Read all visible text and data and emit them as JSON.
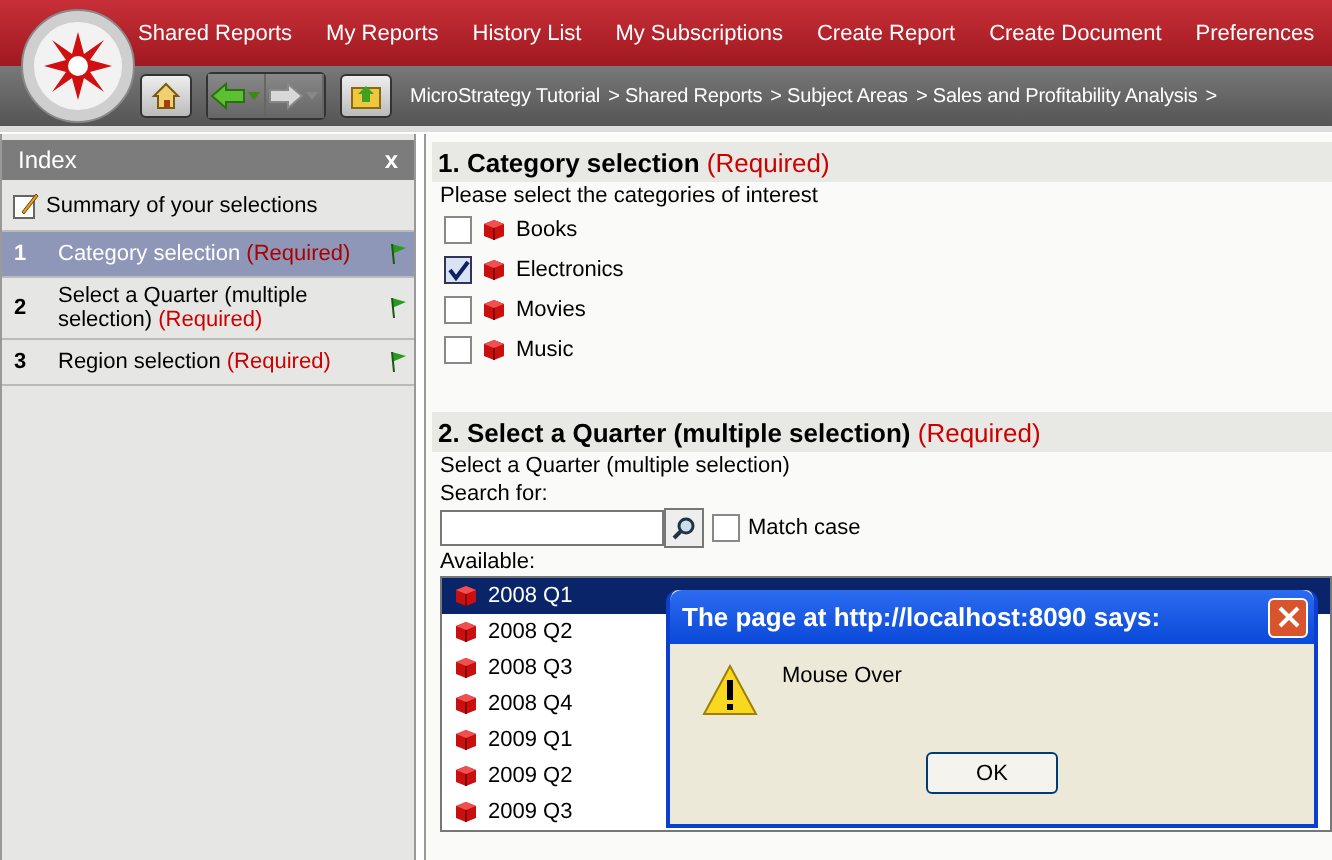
{
  "header": {
    "nav": [
      "Shared Reports",
      "My Reports",
      "History List",
      "My Subscriptions",
      "Create Report",
      "Create Document",
      "Preferences"
    ]
  },
  "toolbar": {
    "breadcrumb": [
      "MicroStrategy Tutorial",
      "> Shared Reports",
      "> Subject Areas",
      "> Sales and Profitability Analysis",
      ">"
    ]
  },
  "index": {
    "title": "Index",
    "close": "x",
    "summary": "Summary of your selections",
    "items": [
      {
        "number": "1",
        "label": "Category selection",
        "required": "(Required)",
        "selected": true
      },
      {
        "number": "2",
        "label": "Select a Quarter (multiple selection)",
        "required": "(Required)",
        "selected": false
      },
      {
        "number": "3",
        "label": "Region selection",
        "required": "(Required)",
        "selected": false
      }
    ]
  },
  "category": {
    "title": "1. Category selection",
    "required": "(Required)",
    "prompt": "Please select the categories of interest",
    "options": [
      {
        "label": "Books",
        "checked": false
      },
      {
        "label": "Electronics",
        "checked": true
      },
      {
        "label": "Movies",
        "checked": false
      },
      {
        "label": "Music",
        "checked": false
      }
    ]
  },
  "quarter": {
    "title": "2. Select a Quarter (multiple selection)",
    "required": "(Required)",
    "prompt": "Select a Quarter (multiple selection)",
    "search_label": "Search for:",
    "match_case": {
      "label": "Match case",
      "checked": false
    },
    "available_label": "Available:",
    "items": [
      {
        "label": "2008 Q1",
        "selected": true
      },
      {
        "label": "2008 Q2",
        "selected": false
      },
      {
        "label": "2008 Q3",
        "selected": false
      },
      {
        "label": "2008 Q4",
        "selected": false
      },
      {
        "label": "2009 Q1",
        "selected": false
      },
      {
        "label": "2009 Q2",
        "selected": false
      },
      {
        "label": "2009 Q3",
        "selected": false
      }
    ]
  },
  "dialog": {
    "title": "The page at http://localhost:8090 says:",
    "message": "Mouse Over",
    "button": "OK"
  }
}
